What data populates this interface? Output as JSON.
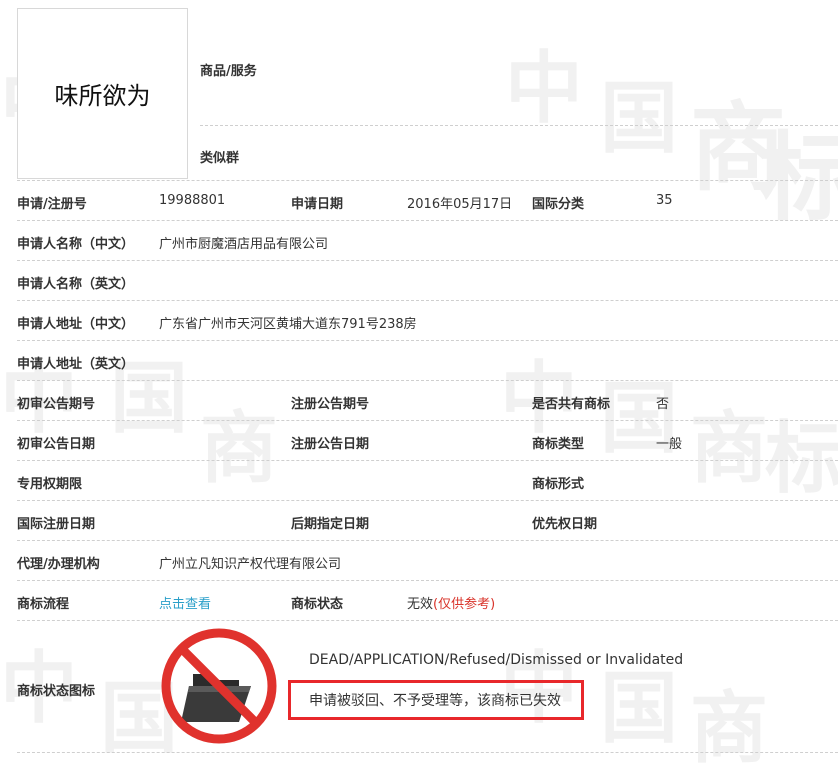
{
  "logo_text": "味所欲为",
  "goods_services_label": "商品/服务",
  "similar_group_label": "类似群",
  "watermark": [
    "中",
    "国",
    "商",
    "标"
  ],
  "rows": {
    "reg_no_label": "申请/注册号",
    "reg_no_value": "19988801",
    "apply_date_label": "申请日期",
    "apply_date_value": "2016年05月17日",
    "intl_class_label": "国际分类",
    "intl_class_value": "35",
    "applicant_cn_label": "申请人名称（中文）",
    "applicant_cn_value": "广州市厨魔酒店用品有限公司",
    "applicant_en_label": "申请人名称（英文）",
    "address_cn_label": "申请人地址（中文）",
    "address_cn_value": "广东省广州市天河区黄埔大道东791号238房",
    "address_en_label": "申请人地址（英文）",
    "prelim_issue_label": "初审公告期号",
    "reg_issue_label": "注册公告期号",
    "shared_label": "是否共有商标",
    "shared_value": "否",
    "prelim_date_label": "初审公告日期",
    "reg_date_label": "注册公告日期",
    "tm_type_label": "商标类型",
    "tm_type_value": "一般",
    "exclusive_period_label": "专用权期限",
    "tm_form_label": "商标形式",
    "intl_reg_date_label": "国际注册日期",
    "later_designation_label": "后期指定日期",
    "priority_date_label": "优先权日期",
    "agency_label": "代理/办理机构",
    "agency_value": "广州立凡知识产权代理有限公司",
    "process_label": "商标流程",
    "process_link": "点击查看",
    "status_label": "商标状态",
    "status_value": "无效",
    "status_note": "(仅供参考)",
    "status_icon_label": "商标状态图标"
  },
  "status_english": "DEAD/APPLICATION/Refused/Dismissed or Invalidated",
  "status_cn_note": "申请被驳回、不予受理等，该商标已失效",
  "colors": {
    "link": "#2a9fc9",
    "status_red": "#d9342b",
    "box_red": "#e8282b",
    "prohibit_red": "#e0322d",
    "folder_dark": "#2b2b2b"
  },
  "icons": [
    "dead-folder-prohibited-icon"
  ]
}
